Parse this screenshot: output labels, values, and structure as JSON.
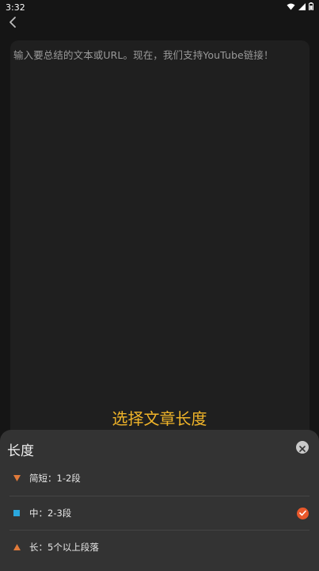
{
  "status_bar": {
    "time": "3:32",
    "icons": [
      "wifi-icon",
      "signal-icon",
      "battery-icon"
    ]
  },
  "header": {
    "back_icon": "chevron-left-icon"
  },
  "input": {
    "placeholder": "输入要总结的文本或URL。现在，我们支持YouTube链接！"
  },
  "prompt": {
    "title": "选择文章长度"
  },
  "sheet": {
    "title": "长度",
    "close_icon": "close-icon",
    "options": [
      {
        "label": "简短：1-2段",
        "icon": "triangle-down-icon",
        "icon_color": "#e07a3a",
        "selected": false
      },
      {
        "label": "中：2-3段",
        "icon": "square-icon",
        "icon_color": "#2aa7dd",
        "selected": true
      },
      {
        "label": "长：5个以上段落",
        "icon": "triangle-up-icon",
        "icon_color": "#e07a3a",
        "selected": false
      }
    ]
  },
  "colors": {
    "background": "#151515",
    "textarea": "#1f1f1f",
    "sheet": "#333333",
    "accent_yellow": "#f0b429",
    "accent_orange": "#e8582b",
    "accent_blue": "#2aa7dd"
  }
}
